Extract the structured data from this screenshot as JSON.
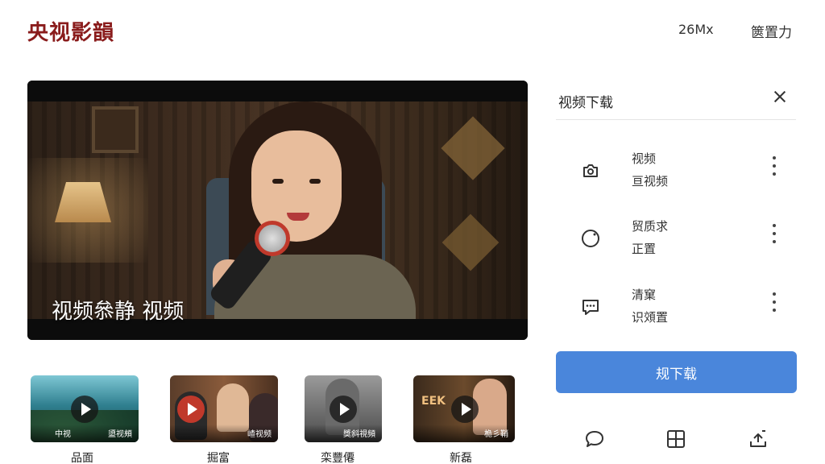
{
  "header": {
    "logo": "央视影韻",
    "item_a": "26Mx",
    "item_b": "篋置力"
  },
  "player": {
    "caption": "视频叅静 视频"
  },
  "thumbnails": [
    {
      "left": "中视",
      "right": "盨视頰",
      "label": "品面"
    },
    {
      "left": "",
      "right": "嵖视频",
      "label": "掘富"
    },
    {
      "left": "",
      "right": "獎斜視頻",
      "label": "栾豐僊"
    },
    {
      "left": "",
      "right": "桅彡鞘",
      "label": "新磊",
      "neon": "EEK"
    }
  ],
  "panel": {
    "title": "视频下载",
    "rows": [
      {
        "line1": "视频",
        "line2": "亘视频",
        "icon": "camera-icon"
      },
      {
        "line1": "贸质求",
        "line2": "正置",
        "icon": "circle-icon"
      },
      {
        "line1": "清窠",
        "line2": "识頝置",
        "icon": "chat-bubble-icon"
      }
    ],
    "download_label": "规下载"
  },
  "colors": {
    "brand": "#8a1c1c",
    "accent": "#4a86db"
  }
}
